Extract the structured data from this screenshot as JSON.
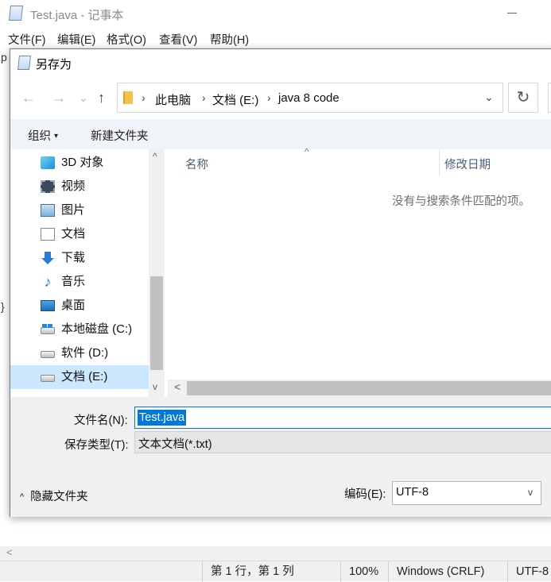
{
  "notepad": {
    "title": "Test.java - 记事本",
    "menu": [
      "文件(F)",
      "编辑(E)",
      "格式(O)",
      "查看(V)",
      "帮助(H)"
    ],
    "edge_text_top": "p",
    "edge_text_mid": "}",
    "scroll_left_glyph": "<",
    "status": {
      "position": "第 1 行，第 1 列",
      "zoom": "100%",
      "line_ending": "Windows (CRLF)",
      "encoding": "UTF-8"
    }
  },
  "dialog": {
    "title": "另存为",
    "nav": {
      "back": "←",
      "forward": "→",
      "recent": "⌄",
      "up": "↑"
    },
    "breadcrumb": [
      "此电脑",
      "文档 (E:)",
      "java 8 code"
    ],
    "breadcrumb_sep": "›",
    "address_dropdown": "⌄",
    "refresh": "↻",
    "toolbar": {
      "organize": "组织",
      "organize_caret": "▾",
      "new_folder": "新建文件夹"
    },
    "nav_items": [
      {
        "label": "3D 对象",
        "icon": "3d-objects-icon"
      },
      {
        "label": "视频",
        "icon": "video-icon"
      },
      {
        "label": "图片",
        "icon": "pictures-icon"
      },
      {
        "label": "文档",
        "icon": "documents-icon"
      },
      {
        "label": "下载",
        "icon": "downloads-icon"
      },
      {
        "label": "音乐",
        "icon": "music-icon"
      },
      {
        "label": "桌面",
        "icon": "desktop-icon"
      },
      {
        "label": "本地磁盘 (C:)",
        "icon": "system-drive-icon"
      },
      {
        "label": "软件 (D:)",
        "icon": "drive-icon"
      },
      {
        "label": "文档 (E:)",
        "icon": "drive-icon",
        "selected": true
      }
    ],
    "scroll_up": "^",
    "scroll_down": "v",
    "scroll_left": "<",
    "columns": {
      "name": "名称",
      "date_modified": "修改日期",
      "sort_caret": "^"
    },
    "empty_message": "没有与搜索条件匹配的项。",
    "filename_label": "文件名(N):",
    "filename_value": "Test.java",
    "filetype_label": "保存类型(T):",
    "filetype_value": "文本文档(*.txt)",
    "hide_folders": "隐藏文件夹",
    "hide_folders_caret": "^",
    "encoding_label": "编码(E):",
    "encoding_value": "UTF-8",
    "encoding_dropdown": "v"
  }
}
